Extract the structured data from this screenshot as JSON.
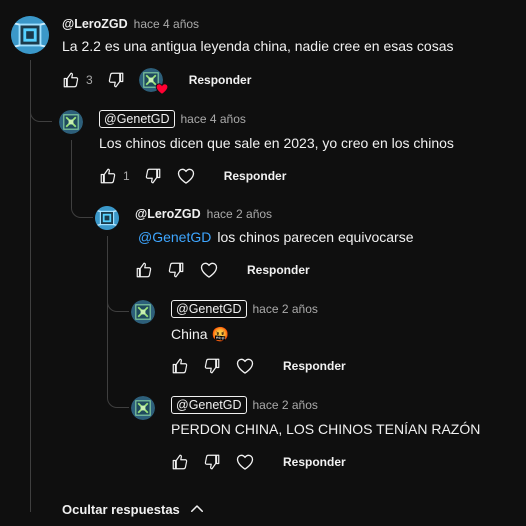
{
  "colors": {
    "background": "#0f0f0f",
    "text": "#f1f1f1",
    "secondary": "#aaaaaa",
    "mention": "#3ea6ff",
    "heart": "#ff0033"
  },
  "comments": [
    {
      "author": "@LeroZGD",
      "time": "hace 4 años",
      "text": "La 2.2 es una antigua leyenda china, nadie cree en esas cosas",
      "likes": "3",
      "reply_label": "Responder",
      "creator_heart": true,
      "icons": [
        "like-icon",
        "dislike-icon",
        "creator-heart-icon"
      ]
    },
    {
      "author": "@GenetGD",
      "time": "hace 4 años",
      "text": "Los chinos dicen que sale en 2023, yo creo en los chinos",
      "likes": "1",
      "reply_label": "Responder",
      "icons": [
        "like-icon",
        "dislike-icon",
        "heart-outline-icon"
      ]
    },
    {
      "author": "@LeroZGD",
      "time": "hace 2 años",
      "mention": "@GenetGD",
      "text": "los chinos parecen equivocarse",
      "reply_label": "Responder",
      "icons": [
        "like-icon",
        "dislike-icon",
        "heart-outline-icon"
      ]
    },
    {
      "author": "@GenetGD",
      "time": "hace 2 años",
      "text": "China 🤬",
      "reply_label": "Responder",
      "icons": [
        "like-icon",
        "dislike-icon",
        "heart-outline-icon"
      ]
    },
    {
      "author": "@GenetGD",
      "time": "hace 2 años",
      "text": "PERDON CHINA, LOS CHINOS TENÍAN RAZÓN",
      "reply_label": "Responder",
      "icons": [
        "like-icon",
        "dislike-icon",
        "heart-outline-icon"
      ]
    }
  ],
  "hide_replies": {
    "label": "Ocultar respuestas",
    "icon": "chevron-up-icon"
  }
}
